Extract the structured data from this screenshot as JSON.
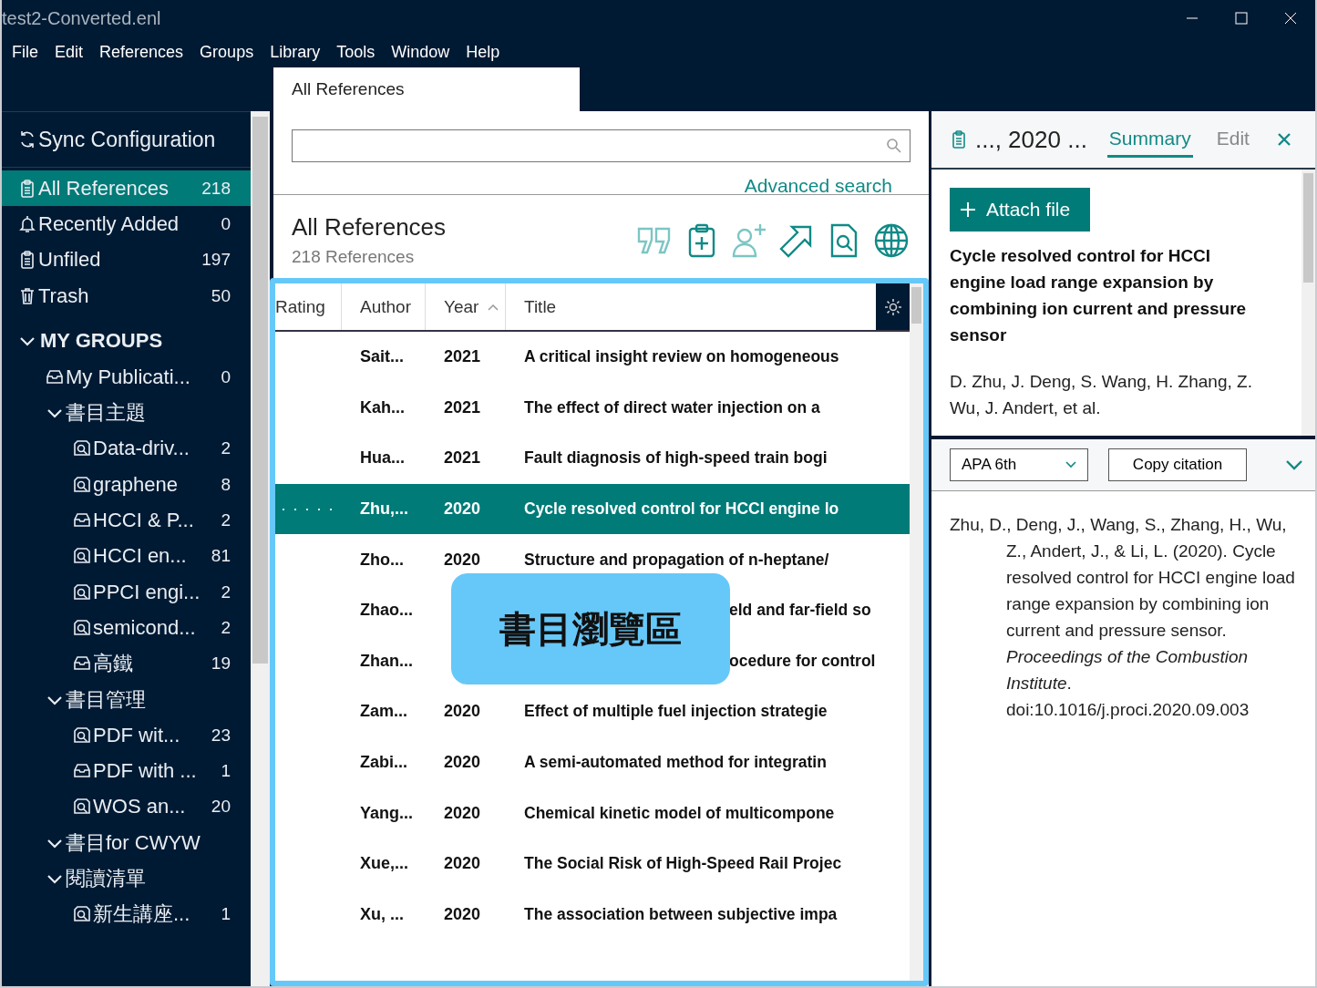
{
  "window": {
    "title": "test2-Converted.enl"
  },
  "menu": [
    "File",
    "Edit",
    "References",
    "Groups",
    "Library",
    "Tools",
    "Window",
    "Help"
  ],
  "library_tab": {
    "label": "All References",
    "selected": true
  },
  "sidebar": {
    "sync": "Sync Configuration",
    "items": [
      {
        "label": "All References",
        "count": "218",
        "kind": "clipboard",
        "selected": true
      },
      {
        "label": "Recently Added",
        "count": "0",
        "kind": "bell",
        "selected": false
      },
      {
        "label": "Unfiled",
        "count": "197",
        "kind": "clipboard",
        "selected": false
      },
      {
        "label": "Trash",
        "count": "50",
        "kind": "trash",
        "selected": false
      }
    ],
    "groups": {
      "label": "MY GROUPS",
      "expanded": true,
      "children": [
        {
          "label": "My Publicati...",
          "count": "0",
          "kind": "group"
        },
        {
          "label": "書目主題",
          "kind": "set",
          "expanded": true,
          "children": [
            {
              "label": "Data-driv...",
              "count": "2",
              "kind": "smart"
            },
            {
              "label": "graphene",
              "count": "8",
              "kind": "smart"
            },
            {
              "label": "HCCI & P...",
              "count": "2",
              "kind": "group"
            },
            {
              "label": "HCCI en...",
              "count": "81",
              "kind": "smart"
            },
            {
              "label": "PPCI engi...",
              "count": "2",
              "kind": "smart"
            },
            {
              "label": "semicond...",
              "count": "2",
              "kind": "smart"
            },
            {
              "label": "高鐵",
              "count": "19",
              "kind": "group"
            }
          ]
        },
        {
          "label": "書目管理",
          "kind": "set",
          "expanded": true,
          "children": [
            {
              "label": "PDF wit...",
              "count": "23",
              "kind": "smart"
            },
            {
              "label": "PDF with ...",
              "count": "1",
              "kind": "group"
            },
            {
              "label": "WOS an...",
              "count": "20",
              "kind": "smart"
            }
          ]
        },
        {
          "label": "書目for CWYW",
          "kind": "set",
          "expanded": true
        },
        {
          "label": "閱讀清單",
          "kind": "set",
          "expanded": true,
          "children": [
            {
              "label": "新生講座...",
              "count": "1",
              "kind": "smart"
            }
          ]
        }
      ]
    }
  },
  "search": {
    "advanced_link": "Advanced search"
  },
  "list_header": {
    "title": "All References",
    "subtitle": "218 References"
  },
  "table": {
    "columns": [
      {
        "label": "Rating"
      },
      {
        "label": "Author"
      },
      {
        "label": "Year",
        "sorted": true
      },
      {
        "label": "Title"
      }
    ],
    "rows": [
      {
        "author": "Sait...",
        "year": "2021",
        "title": "A critical insight review on homogeneous",
        "selected": false,
        "kind": "plain"
      },
      {
        "author": "Kah...",
        "year": "2021",
        "title": "The effect of direct water injection on a",
        "selected": false,
        "kind": "plain"
      },
      {
        "author": "Hua...",
        "year": "2021",
        "title": "Fault diagnosis of high-speed train bogi",
        "selected": false,
        "kind": "plain"
      },
      {
        "rating": "· · · · ·",
        "author": "Zhu,...",
        "year": "2020",
        "title": "Cycle resolved control for HCCI engine lo",
        "selected": true,
        "kind": "plain"
      },
      {
        "author": "Zho...",
        "year": "2020",
        "title": "Structure and propagation of n-heptane/",
        "selected": false,
        "kind": "plain"
      },
      {
        "author": "Zhao...",
        "title": "eld and far-field so",
        "selected": false,
        "kind": "covered"
      },
      {
        "author": "Zhan...",
        "title": "ocedure for control",
        "selected": false,
        "kind": "covered"
      },
      {
        "author": "Zam...",
        "year": "2020",
        "title": "Effect of multiple fuel injection strategie",
        "selected": false,
        "kind": "plain"
      },
      {
        "author": "Zabi...",
        "year": "2020",
        "title": "A semi-automated method for integratin",
        "selected": false,
        "kind": "plain"
      },
      {
        "author": "Yang...",
        "year": "2020",
        "title": "Chemical kinetic model of multicompone",
        "selected": false,
        "kind": "plain"
      },
      {
        "author": "Xue,...",
        "year": "2020",
        "title": "The Social Risk of High-Speed Rail Projec",
        "selected": false,
        "kind": "plain"
      },
      {
        "author": "Xu, ...",
        "year": "2020",
        "title": "The association between subjective impa",
        "selected": false,
        "kind": "plain"
      }
    ]
  },
  "callout": {
    "text": "書目瀏覽區"
  },
  "detail": {
    "heading": "..., 2020 ...",
    "tabs": [
      {
        "label": "Summary",
        "selected": true
      },
      {
        "label": "Edit",
        "selected": false
      }
    ],
    "attach_button": "Attach file",
    "ref_title": "Cycle resolved control for HCCI engine load range expansion by combining ion current and pressure sensor",
    "ref_authors": "D. Zhu, J. Deng, S. Wang, H. Zhang, Z. Wu, J. Andert, et al.",
    "style_select": "APA 6th",
    "copy_button": "Copy citation",
    "citation": "Zhu, D., Deng, J., Wang, S., Zhang, H., Wu, Z., Andert, J., & Li, L. (2020). Cycle resolved control for HCCI engine load range expansion by combining ion current and pressure sensor. *Proceedings of the Combustion Institute*. doi:10.1016/j.proci.2020.09.003"
  }
}
